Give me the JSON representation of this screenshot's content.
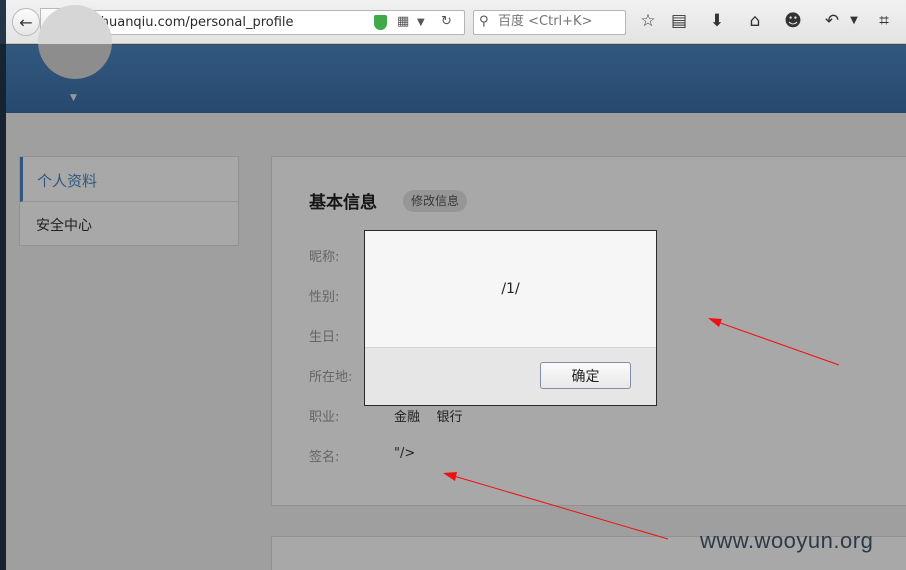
{
  "browser": {
    "back_glyph": "←",
    "forward_glyph": "→",
    "url": "i.huanqiu.com/personal_profile",
    "search_placeholder": "百度 <Ctrl+K>",
    "icons": [
      "back-icon",
      "forward-icon",
      "globe-icon",
      "shield-icon",
      "qr-icon",
      "reload-icon",
      "search-icon",
      "bookmark-star-icon",
      "reader-icon",
      "download-icon",
      "home-icon",
      "smiley-icon",
      "undo-icon",
      "crop-icon"
    ]
  },
  "sidebar": {
    "items": [
      {
        "label": "个人资料",
        "active": true
      },
      {
        "label": "安全中心",
        "active": false
      }
    ]
  },
  "profile": {
    "section_title": "基本信息",
    "edit_label": "修改信息",
    "fields": [
      {
        "label": "昵称:",
        "value": ""
      },
      {
        "label": "性别:",
        "value": ""
      },
      {
        "label": "生日:",
        "value": ""
      },
      {
        "label": "所在地:",
        "value": ""
      },
      {
        "label": "职业:",
        "value": "金融    银行"
      },
      {
        "label": "签名:",
        "value": "\"/>"
      }
    ]
  },
  "dialog": {
    "message": "/1/",
    "ok_label": "确定"
  },
  "annotations": {
    "arrow_color": "#ee1111"
  },
  "watermark": "www.wooyun.org",
  "colors": {
    "accent": "#4d86c2"
  }
}
